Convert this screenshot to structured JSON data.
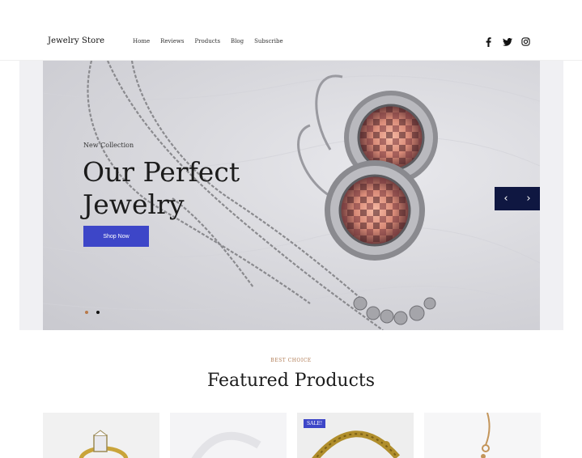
{
  "header": {
    "logo": "Jewelry Store",
    "nav": [
      "Home",
      "Reviews",
      "Products",
      "Blog",
      "Subscribe"
    ],
    "social_icons": [
      "facebook-icon",
      "twitter-icon",
      "instagram-icon"
    ]
  },
  "hero": {
    "eyebrow": "New Collection",
    "title": "Our Perfect Jewelry",
    "button": "Shop Now",
    "prev_arrow": "‹",
    "next_arrow": "›",
    "slide_count": 2,
    "active_slide": 2
  },
  "featured": {
    "eyebrow": "BEST CHOICE",
    "title": "Featured Products",
    "products": [
      {
        "badge": ""
      },
      {
        "badge": ""
      },
      {
        "badge": "SALE!"
      },
      {
        "badge": ""
      }
    ]
  },
  "colors": {
    "accent": "#3d46c8",
    "slider_nav": "#0f1741",
    "dot_inactive": "#b87a4b",
    "eyebrow": "#b07b54"
  }
}
